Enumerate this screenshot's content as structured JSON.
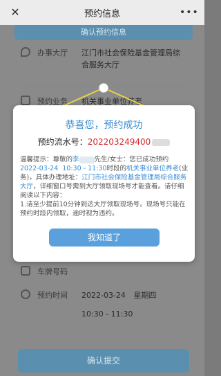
{
  "topbar": {
    "title": "预约信息",
    "close_icon": "close-icon",
    "more_icon": "more-icon"
  },
  "page": {
    "confirm_header": "确认预约信息",
    "rows": [
      {
        "label": "办事大厅",
        "value": "江门市社会保险基金管理局综合服务大厅",
        "icon": "location-icon"
      },
      {
        "label": "预约业务",
        "value": "机关事业单位养老",
        "icon": "document-icon"
      },
      {
        "label": "车牌号码",
        "value": "",
        "icon": "car-icon"
      },
      {
        "label": "预约时间",
        "value_date": "2022-03-24",
        "value_weekday": "星期四",
        "value_time": "10:30 - 11:30",
        "icon": "clock-icon"
      }
    ],
    "submit_label": "确认提交"
  },
  "modal": {
    "title": "恭喜您，预约成功",
    "serial_label": "预约流水号：",
    "serial_number": "202203249400",
    "tips": {
      "p1_a": "温馨提示：尊敬的",
      "p1_name": "李",
      "p1_b": "先生/女士：您已成功预约",
      "p1_date": "2022-03-24",
      "p1_time": "10:30 - 11:30",
      "p1_c": "时段的",
      "p1_business": "机关事业单位养老",
      "p1_d": "(业务)，具体办理地址：",
      "p1_address": "江门市社会保险基金管理局综合服务大厅",
      "p1_e": "，详细窗口号需到大厅领取现场号才能查看。请仔细阅读以下内容：",
      "p2": "1.请至少提前10分钟到达大厅领取现场号。现场号只能在",
      "p3": "预约时段内领取，逾时视为违约。"
    },
    "ok_label": "我知道了"
  }
}
